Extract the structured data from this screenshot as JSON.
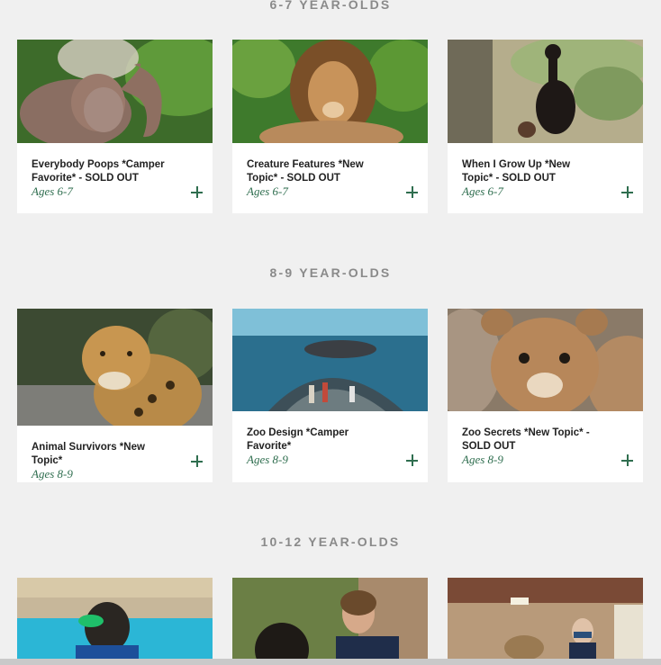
{
  "sections": [
    {
      "heading": "6-7 YEAR-OLDS",
      "cards": [
        {
          "title": "Everybody Poops *Camper Favorite* - SOLD OUT",
          "ages": "Ages 6-7",
          "image": "elephant"
        },
        {
          "title": "Creature Features *New Topic* - SOLD OUT",
          "ages": "Ages 6-7",
          "image": "lion"
        },
        {
          "title": "When I Grow Up *New Topic* - SOLD OUT",
          "ages": "Ages 6-7",
          "image": "bird"
        }
      ]
    },
    {
      "heading": "8-9 YEAR-OLDS",
      "cards": [
        {
          "title": "Animal Survivors *New Topic*",
          "ages": "Ages 8-9",
          "image": "jaguar"
        },
        {
          "title": "Zoo Design *Camper Favorite*",
          "ages": "Ages 8-9",
          "image": "aquarium-tunnel"
        },
        {
          "title": "Zoo Secrets *New Topic* - SOLD OUT",
          "ages": "Ages 8-9",
          "image": "cougar-cub"
        }
      ]
    },
    {
      "heading": "10-12 YEAR-OLDS",
      "cards": [
        {
          "title": "",
          "ages": "",
          "image": "sea-lion"
        },
        {
          "title": "",
          "ages": "",
          "image": "bear-keeper"
        },
        {
          "title": "",
          "ages": "",
          "image": "giraffe-keeper"
        }
      ]
    }
  ],
  "icons": {
    "expand": "plus-icon"
  },
  "colors": {
    "background": "#f0f0f0",
    "heading": "#8a8a8a",
    "ages": "#2f6e4f",
    "plus": "#2f6e4f"
  }
}
